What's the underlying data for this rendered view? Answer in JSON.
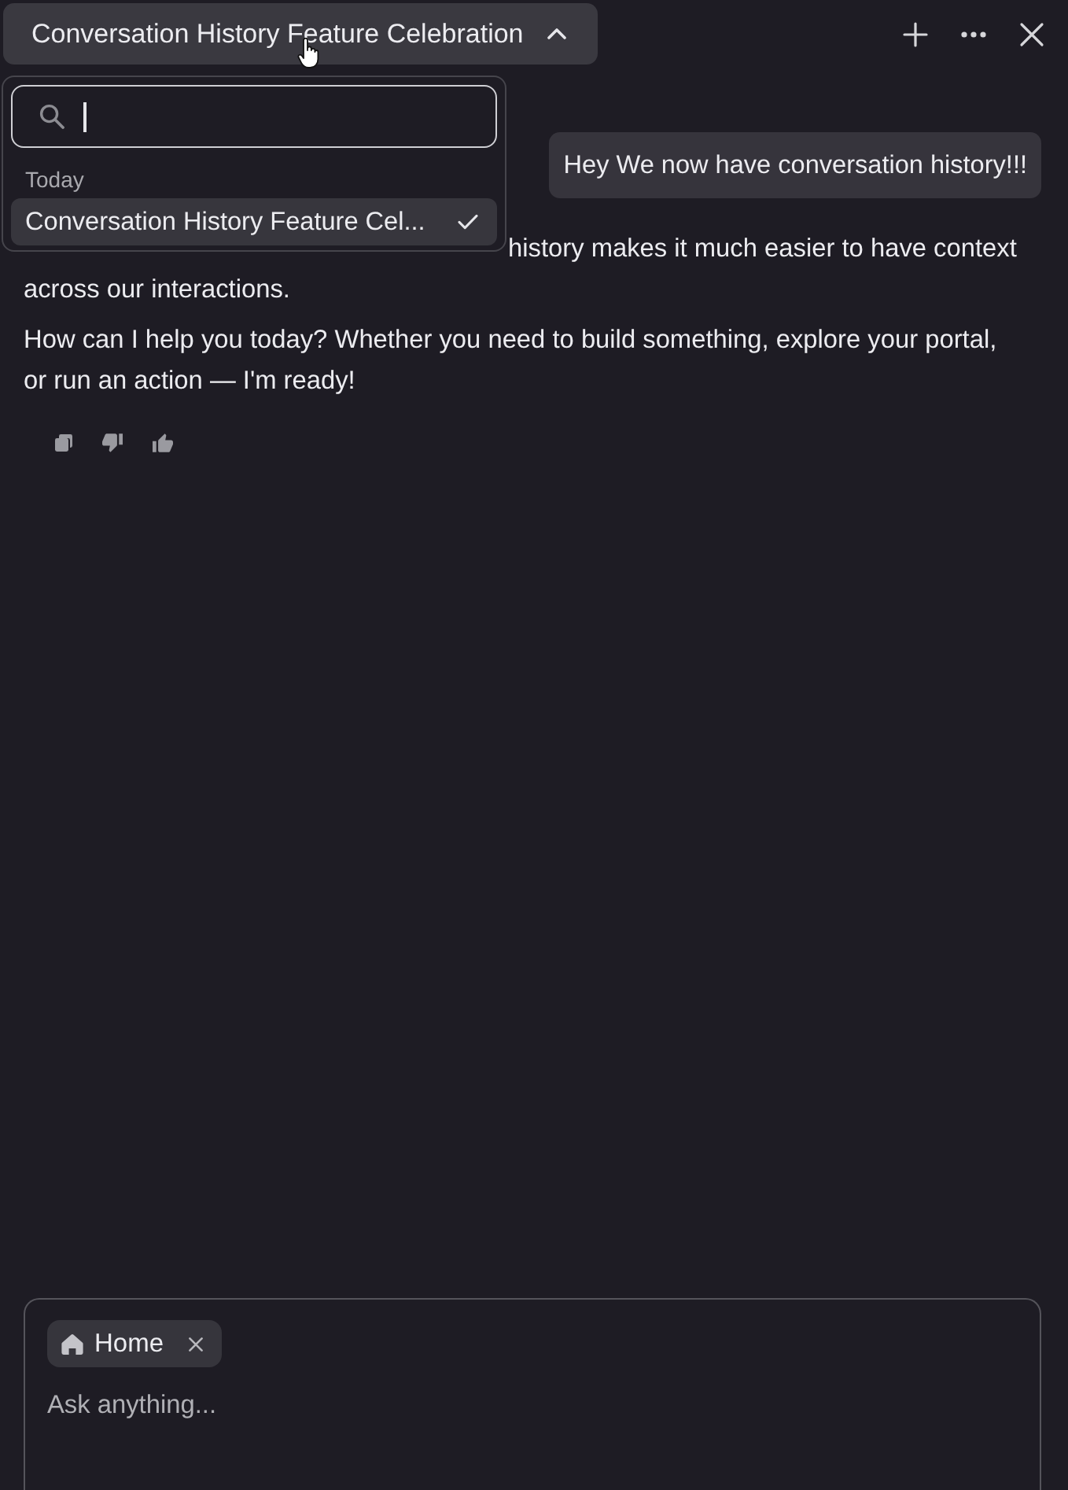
{
  "header": {
    "title": "Conversation History Feature Celebration",
    "expanded": true
  },
  "history_menu": {
    "search": {
      "focused": true
    },
    "groups": [
      {
        "label": "Today",
        "items": [
          {
            "title": "Conversation History Feature Cel...",
            "selected": true
          }
        ]
      }
    ]
  },
  "messages": [
    {
      "kind": "user",
      "text": "Hey We now have conversation history!!!"
    },
    {
      "kind": "assistant",
      "paragraphs": [
        "history makes it much easier to have context across our interactions.",
        "How can I help you today? Whether you need to build something, explore your portal, or run an action — I'm ready!"
      ]
    }
  ],
  "composer": {
    "chips": [
      {
        "label": "Home"
      }
    ],
    "placeholder": "Ask anything..."
  }
}
